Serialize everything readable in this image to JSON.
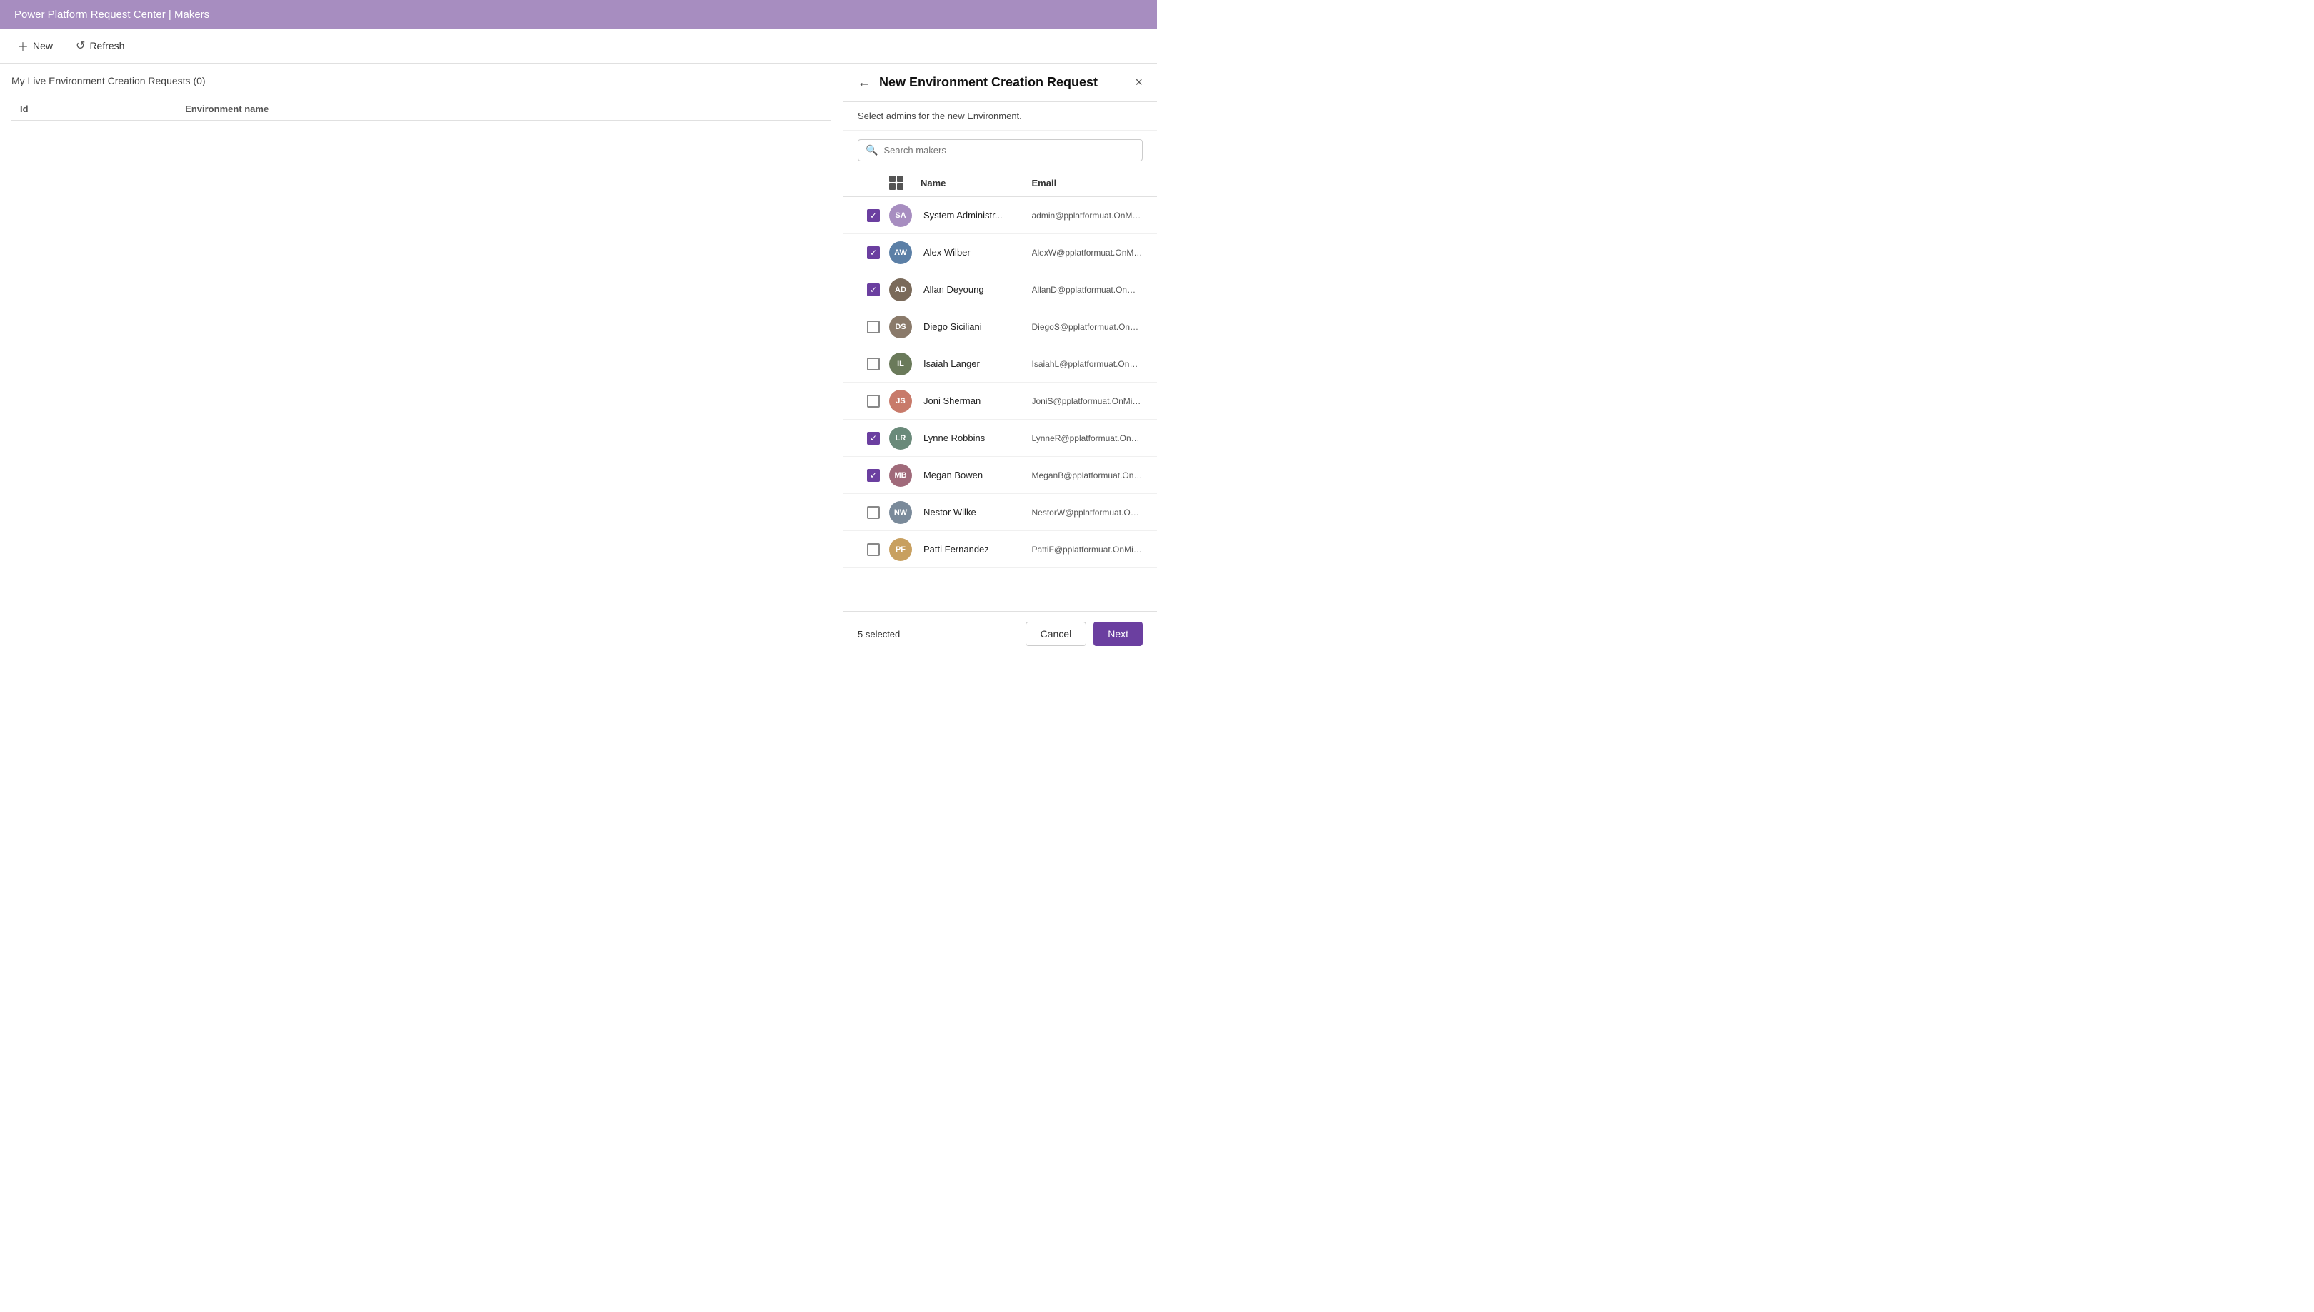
{
  "app": {
    "title": "Power Platform Request Center | Makers"
  },
  "action_bar": {
    "new_label": "New",
    "refresh_label": "Refresh"
  },
  "main": {
    "section_title": "My Live Environment Creation Requests (0)",
    "table": {
      "columns": [
        "Id",
        "Environment name"
      ],
      "rows": []
    }
  },
  "drawer": {
    "title": "New Environment Creation Request",
    "subtitle": "Select admins for the new Environment.",
    "search_placeholder": "Search makers",
    "close_label": "×",
    "table": {
      "col_name": "Name",
      "col_email": "Email"
    },
    "makers": [
      {
        "id": "system-admin",
        "name": "System Administr...",
        "email": "admin@pplatformuat.OnMicrosoft.co...",
        "checked": true,
        "initials": "SA",
        "color": "#a78dc0"
      },
      {
        "id": "alex-wilber",
        "name": "Alex Wilber",
        "email": "AlexW@pplatformuat.OnMicrosoft.c...",
        "checked": true,
        "initials": "AW",
        "color": "#5b7fa6"
      },
      {
        "id": "allan-deyoung",
        "name": "Allan Deyoung",
        "email": "AllanD@pplatformuat.OnMicrosoft.c...",
        "checked": true,
        "initials": "AD",
        "color": "#7a6a5a"
      },
      {
        "id": "diego-siciliani",
        "name": "Diego Siciliani",
        "email": "DiegoS@pplatformuat.OnMicrosoft.c...",
        "checked": false,
        "initials": "DS",
        "color": "#8a7a6a"
      },
      {
        "id": "isaiah-langer",
        "name": "Isaiah Langer",
        "email": "IsaiahL@pplatformuat.OnMicrosoft.c...",
        "checked": false,
        "initials": "IL",
        "color": "#6a7a5a"
      },
      {
        "id": "joni-sherman",
        "name": "Joni Sherman",
        "email": "JoniS@pplatformuat.OnMicrosoft.com",
        "checked": false,
        "initials": "JS",
        "color": "#c87a6a"
      },
      {
        "id": "lynne-robbins",
        "name": "Lynne Robbins",
        "email": "LynneR@pplatformuat.OnMicrosoft.c...",
        "checked": true,
        "initials": "LR",
        "color": "#6a8a7a"
      },
      {
        "id": "megan-bowen",
        "name": "Megan Bowen",
        "email": "MeganB@pplatformuat.OnMicrosoft....",
        "checked": true,
        "initials": "MB",
        "color": "#a06a7a"
      },
      {
        "id": "nestor-wilke",
        "name": "Nestor Wilke",
        "email": "NestorW@pplatformuat.OnMicrosoft....",
        "checked": false,
        "initials": "NW",
        "color": "#7a8a9a"
      },
      {
        "id": "patti-fernandez",
        "name": "Patti Fernandez",
        "email": "PattiF@pplatformuat.OnMicrosoft.com",
        "checked": false,
        "initials": "PF",
        "color": "#c8a060"
      }
    ],
    "footer": {
      "selected_count": "5 selected",
      "cancel_label": "Cancel",
      "next_label": "Next"
    }
  }
}
